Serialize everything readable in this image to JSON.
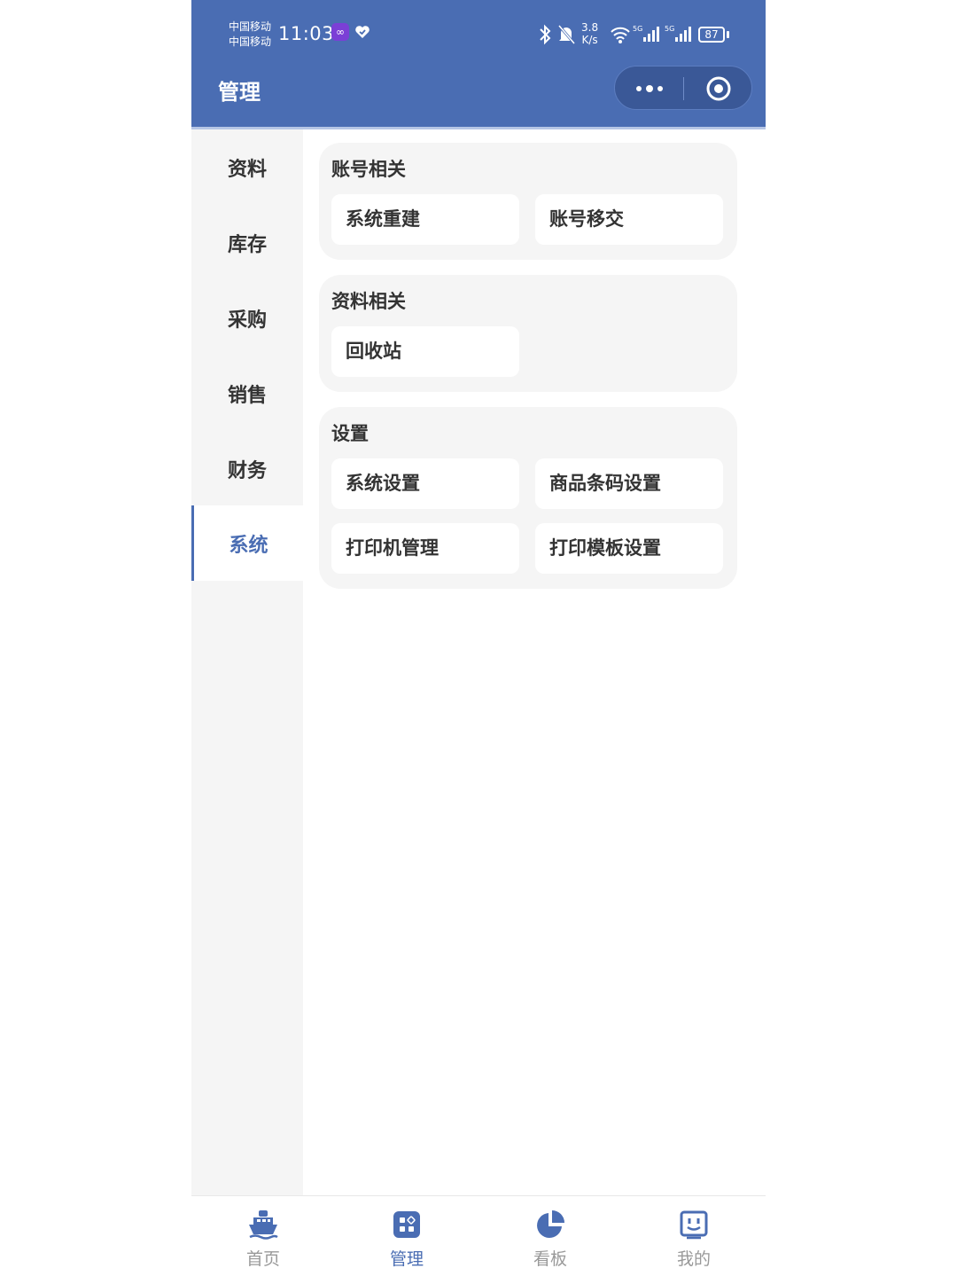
{
  "status_bar": {
    "carrier1": "中国移动",
    "carrier2": "中国移动",
    "time": "11:03",
    "net_speed_value": "3.8",
    "net_speed_unit": "K/s",
    "signal1_label": "5G",
    "signal2_label": "5G",
    "battery": "87"
  },
  "header": {
    "title": "管理",
    "more_icon": "more-dots-icon",
    "close_icon": "target-circle-icon"
  },
  "sidebar": {
    "items": [
      {
        "label": "资料"
      },
      {
        "label": "库存"
      },
      {
        "label": "采购"
      },
      {
        "label": "销售"
      },
      {
        "label": "财务"
      },
      {
        "label": "系统",
        "active": true
      }
    ]
  },
  "sections": [
    {
      "title": "账号相关",
      "items": [
        "系统重建",
        "账号移交"
      ]
    },
    {
      "title": "资料相关",
      "items": [
        "回收站"
      ]
    },
    {
      "title": "设置",
      "items": [
        "系统设置",
        "商品条码设置",
        "打印机管理",
        "打印模板设置"
      ]
    }
  ],
  "tabbar": {
    "tabs": [
      {
        "label": "首页",
        "icon": "ship-icon"
      },
      {
        "label": "管理",
        "icon": "grid-icon",
        "active": true
      },
      {
        "label": "看板",
        "icon": "pie-chart-icon"
      },
      {
        "label": "我的",
        "icon": "smiley-box-icon"
      }
    ]
  },
  "colors": {
    "primary": "#4a6db3",
    "background_gray": "#f5f5f5",
    "text_dark": "#333333",
    "text_inactive": "#999999"
  }
}
